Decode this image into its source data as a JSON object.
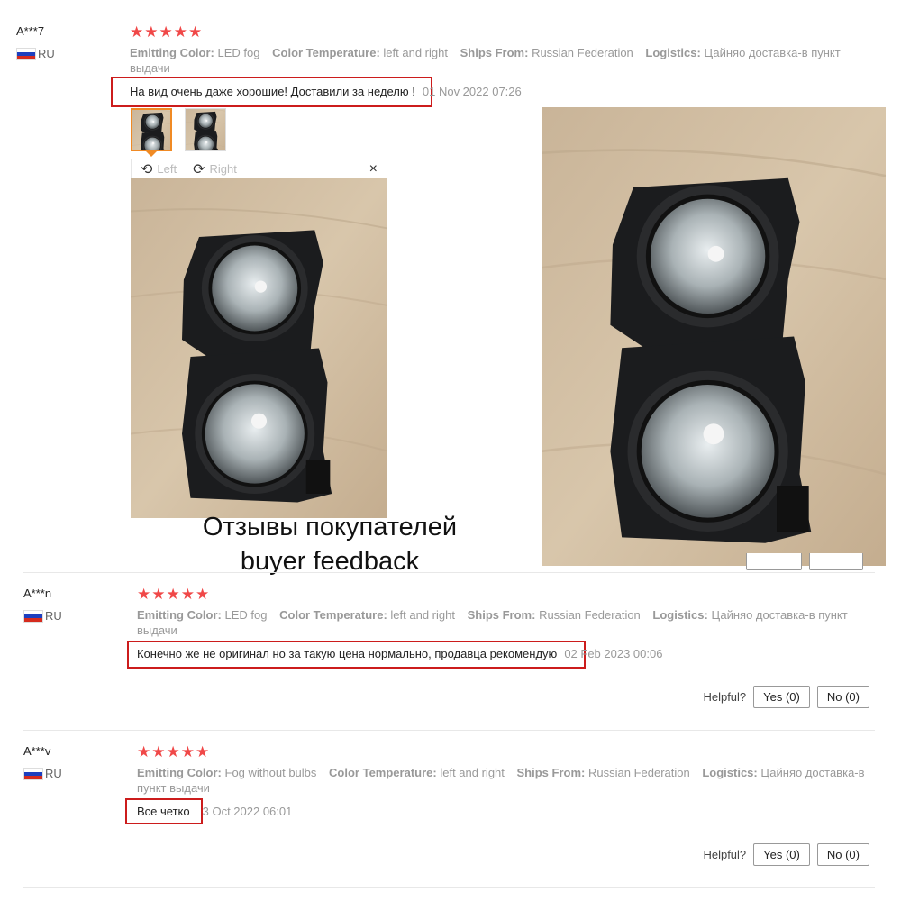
{
  "caption": {
    "line1": "Отзывы покупателей",
    "line2": "buyer feedback"
  },
  "labels": {
    "emitting_color": "Emitting Color:",
    "color_temperature": "Color Temperature:",
    "ships_from": "Ships From:",
    "logistics": "Logistics:",
    "helpful": "Helpful?",
    "yes": "Yes (0)",
    "no": "No (0)"
  },
  "viewer": {
    "rotate_left": "Left",
    "rotate_right": "Right",
    "close": "×"
  },
  "reviews": [
    {
      "user": "A***7",
      "country": "RU",
      "stars": "★★★★★",
      "rating": 5,
      "emitting_color": "LED fog",
      "color_temperature": "left and right",
      "ships_from": "Russian Federation",
      "logistics": "Цайняо доставка-в пункт выдачи",
      "comment": "На вид очень даже хорошие! Доставили за неделю !",
      "date": "01 Nov 2022 07:26",
      "photo_count": 2
    },
    {
      "user": "A***n",
      "country": "RU",
      "stars": "★★★★★",
      "rating": 5,
      "emitting_color": "LED fog",
      "color_temperature": "left and right",
      "ships_from": "Russian Federation",
      "logistics": "Цайняо доставка-в пункт выдачи",
      "comment": "Конечно же не оригинал но за такую цена нормально, продавца рекомендую",
      "date": "02 Feb 2023 00:06"
    },
    {
      "user": "A***v",
      "country": "RU",
      "stars": "★★★★★",
      "rating": 5,
      "emitting_color": "Fog without bulbs",
      "color_temperature": "left and right",
      "ships_from": "Russian Federation",
      "logistics": "Цайняо доставка-в пункт выдачи",
      "comment": "Все четко",
      "date": "3 Oct 2022 06:01"
    }
  ],
  "colors": {
    "star": "#f04848",
    "highlight_box": "#cc1c1c",
    "active_thumb": "#f08a24"
  }
}
